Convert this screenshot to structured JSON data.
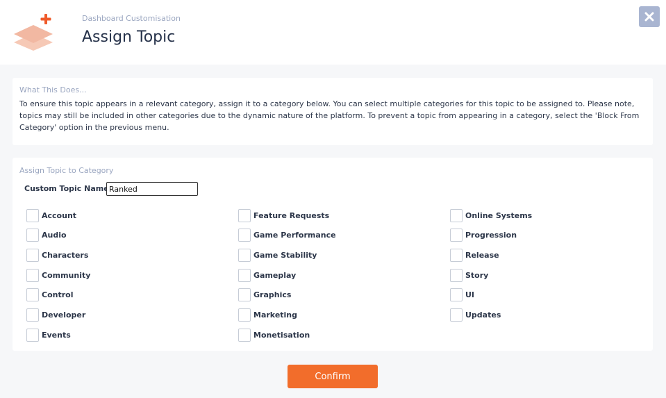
{
  "header": {
    "subtitle": "Dashboard Customisation",
    "title": "Assign Topic",
    "close_icon": "close-icon",
    "logo_icon": "stack-plus-icon",
    "colors": {
      "logo_primary": "#f2b8a2",
      "logo_plus": "#ef5a2a",
      "close_bg": "#a9b5d1"
    }
  },
  "info": {
    "heading": "What This Does...",
    "text": "To ensure this topic appears in a relevant category, assign it to a category below. You can select multiple categories for this topic to be assigned to. Please note, topics may still be included in other categories due to the dynamic nature of the platform. To prevent a topic from appearing in a category, select the 'Block From Category' option in the previous menu."
  },
  "assign": {
    "heading": "Assign Topic to Category",
    "name_label": "Custom Topic Name:",
    "name_value": "Ranked",
    "columns": [
      [
        "Account",
        "Audio",
        "Characters",
        "Community",
        "Control",
        "Developer",
        "Events"
      ],
      [
        "Feature Requests",
        "Game Performance",
        "Game Stability",
        "Gameplay",
        "Graphics",
        "Marketing",
        "Monetisation"
      ],
      [
        "Online Systems",
        "Progression",
        "Release",
        "Story",
        "UI",
        "Updates"
      ]
    ]
  },
  "confirm": {
    "label": "Confirm",
    "color": "#f26d2b"
  }
}
